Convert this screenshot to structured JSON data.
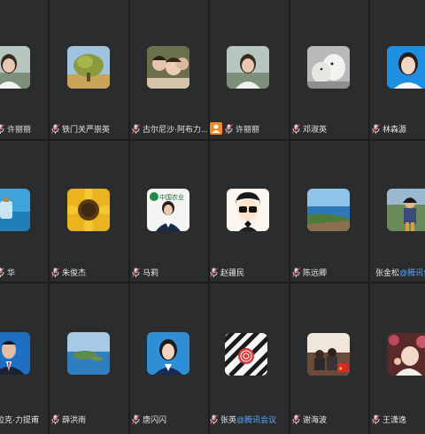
{
  "tiles": [
    {
      "id": "r1c0",
      "name": "许丽丽",
      "avatar": "woman-portrait"
    },
    {
      "id": "r1c1",
      "name": "铁门关严崇英",
      "avatar": "tree-landscape"
    },
    {
      "id": "r1c2",
      "name": "古尔尼沙·阿布力...",
      "avatar": "group-selfie"
    },
    {
      "id": "r1c3",
      "name": "许丽丽",
      "avatar": "woman-portrait",
      "host_badge": true
    },
    {
      "id": "r1c4",
      "name": "邓淑英",
      "avatar": "polar-bears"
    },
    {
      "id": "r1c5",
      "name": "林森源",
      "avatar": "woman-portrait-blue"
    },
    {
      "id": "r2c0",
      "name": "华",
      "avatar": "bottle-ocean"
    },
    {
      "id": "r2c1",
      "name": "朱俊杰",
      "avatar": "sunflower"
    },
    {
      "id": "r2c2",
      "name": "马莉",
      "avatar": "bank-staff",
      "avatar_text": "中国农业"
    },
    {
      "id": "r2c3",
      "name": "赵疆民",
      "avatar": "cartoon-boy"
    },
    {
      "id": "r2c4",
      "name": "陈远卿",
      "avatar": "seascape"
    },
    {
      "id": "r2c5",
      "name": "张金松",
      "suffix": "@腾讯会",
      "avatar": "man-outdoors"
    },
    {
      "id": "r3c0",
      "name": "拉克·力提甫",
      "avatar": "man-suit"
    },
    {
      "id": "r3c1",
      "name": "薛洪雨",
      "avatar": "lake-island"
    },
    {
      "id": "r3c2",
      "name": "唐闪闪",
      "avatar": "woman-blue"
    },
    {
      "id": "r3c3",
      "name": "张英",
      "suffix": "@腾讯会议",
      "avatar": "striped-logo"
    },
    {
      "id": "r3c4",
      "name": "谢海波",
      "avatar": "sunset-people"
    },
    {
      "id": "r3c5",
      "name": "王潇逸",
      "avatar": "baby"
    }
  ]
}
